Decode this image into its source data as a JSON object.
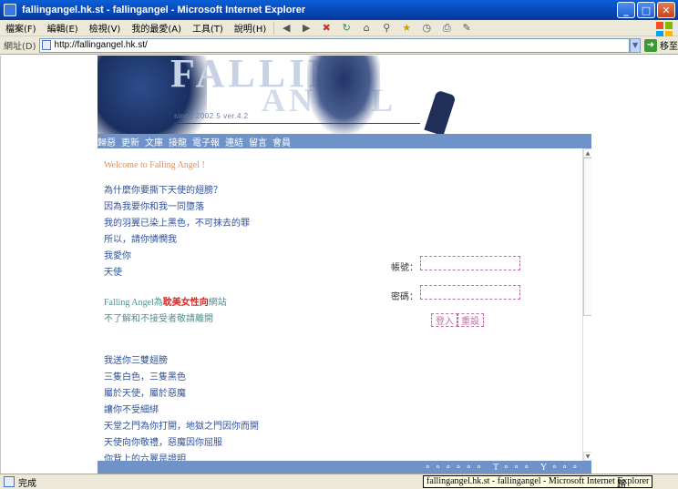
{
  "window": {
    "title": "fallingangel.hk.st - fallingangel - Microsoft Internet Explorer",
    "min_icon": "minimize-icon",
    "max_icon": "maximize-icon",
    "close_icon": "close-icon"
  },
  "menu": {
    "items": [
      "檔案(F)",
      "編輯(E)",
      "檢視(V)",
      "我的最愛(A)",
      "工具(T)",
      "說明(H)"
    ]
  },
  "toolbar": {
    "icons": [
      "back-icon",
      "forward-icon",
      "stop-icon",
      "refresh-icon",
      "home-icon",
      "search-icon",
      "favorites-icon",
      "history-icon",
      "print-icon",
      "edit-icon"
    ]
  },
  "address": {
    "label": "網址(D)",
    "url": "http://fallingangel.hk.st/",
    "go_label": "移至"
  },
  "banner": {
    "logo_text_1": "FALLING",
    "logo_text_2": "ANGEL",
    "since": "since 2002.5  ver.4.2"
  },
  "nav": {
    "items": [
      "歸惡",
      "更新",
      "文庫",
      "接龍",
      "電子報",
      "連結",
      "留言",
      "會員"
    ]
  },
  "content": {
    "welcome": "Welcome to Falling Angel !",
    "poem1": [
      "為什麼你要撕下天使的翅膀？",
      "因為我要你和我一同墮落",
      "我的羽翼已染上黑色，不可抹去的罪",
      "所以，請你憐憫我",
      "我愛你",
      "天使"
    ],
    "note_brand": "Falling Angel",
    "note_prefix": "為",
    "note_highlight": "耽美女性向",
    "note_suffix": "網站",
    "note2": "不了解和不接受者敬請離開",
    "poem2": [
      "我送你三雙翅膀",
      "三隻白色，三隻黑色",
      "屬於天使，屬於惡魔",
      "讓你不受細綁",
      "天堂之門為你打開，地獄之門因你而開",
      "天使向你敬禮，惡魔因你屈服",
      "你背上的六翼是證明"
    ]
  },
  "login": {
    "account_label": "帳號：",
    "password_label": "密碼：",
    "login_btn": "登入",
    "register_btn": "重設"
  },
  "footer": {
    "text": "∘∘∘∘∘∘ T∘∘∘ Y∘∘∘"
  },
  "status": {
    "text": "完成",
    "tooltip": "fallingangel.hk.st - fallingangel - Microsoft Internet Explorer",
    "right": "路"
  }
}
